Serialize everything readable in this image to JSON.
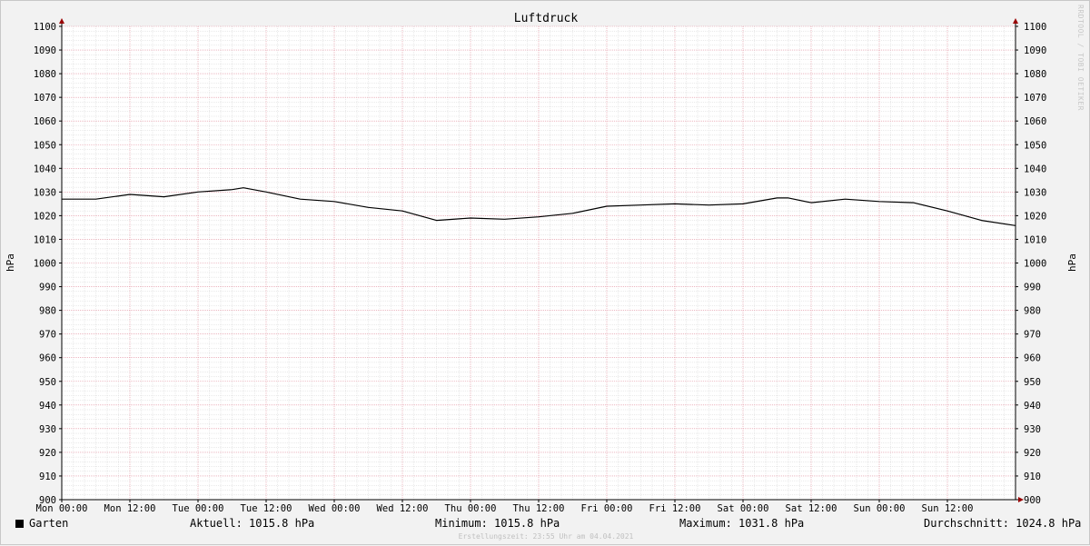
{
  "chart_data": {
    "type": "line",
    "title": "Luftdruck",
    "ylabel": "hPa",
    "ylabel_right": "hPa",
    "ylim": [
      900,
      1100
    ],
    "y_ticks": [
      900,
      910,
      920,
      930,
      940,
      950,
      960,
      970,
      980,
      990,
      1000,
      1010,
      1020,
      1030,
      1040,
      1050,
      1060,
      1070,
      1080,
      1090,
      1100
    ],
    "x_ticks": [
      "Mon 00:00",
      "Mon 12:00",
      "Tue 00:00",
      "Tue 12:00",
      "Wed 00:00",
      "Wed 12:00",
      "Thu 00:00",
      "Thu 12:00",
      "Fri 00:00",
      "Fri 12:00",
      "Sat 00:00",
      "Sat 12:00",
      "Sun 00:00",
      "Sun 12:00"
    ],
    "grid": true,
    "legend": "bottom-left",
    "colors": {
      "line": "#000000",
      "major_grid": "#e08a9a",
      "minor_grid": "#d4d4d4",
      "axis": "#000000",
      "arrow": "#990000",
      "plot_bg": "#ffffff"
    },
    "series": [
      {
        "name": "Garten",
        "x_hours": [
          0,
          6,
          12,
          18,
          24,
          30,
          32,
          36,
          42,
          48,
          54,
          60,
          66,
          72,
          78,
          84,
          90,
          96,
          102,
          108,
          114,
          120,
          126,
          128,
          132,
          138,
          144,
          150,
          156,
          162,
          168
        ],
        "values": [
          1027,
          1027,
          1029,
          1028,
          1030,
          1031,
          1031.8,
          1030,
          1027,
          1026,
          1023.5,
          1022,
          1018,
          1019,
          1018.5,
          1019.5,
          1021,
          1024,
          1024.5,
          1025,
          1024.5,
          1025,
          1027.5,
          1027.5,
          1025.5,
          1027,
          1026,
          1025.5,
          1022,
          1018,
          1015.8
        ]
      }
    ]
  },
  "stats": {
    "series_name": "Garten",
    "current": "Aktuell: 1015.8 hPa",
    "minimum": "Minimum: 1015.8 hPa",
    "maximum": "Maximum: 1031.8 hPa",
    "average": "Durchschnitt: 1024.8 hPa"
  },
  "footer": "Erstellungszeit: 23:55 Uhr am 04.04.2021",
  "watermark": "RRDTOOL / TOBI OETIKER"
}
